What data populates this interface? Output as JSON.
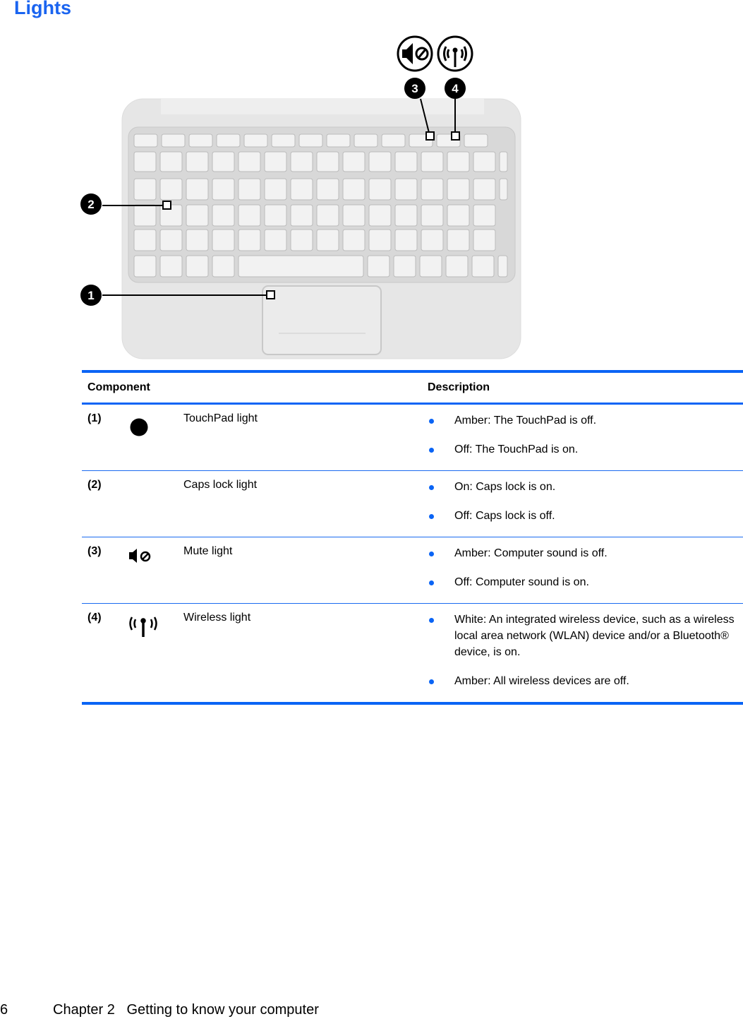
{
  "title": "Lights",
  "figure": {
    "callouts": [
      "1",
      "2",
      "3",
      "4"
    ],
    "callout_icons": [
      "mute-icon",
      "wireless-icon"
    ]
  },
  "table": {
    "headers": [
      "Component",
      "Description"
    ],
    "rows": [
      {
        "num": "(1)",
        "icon": "touchpad-light-icon",
        "name": "TouchPad light",
        "desc": [
          "Amber: The TouchPad is off.",
          "Off: The TouchPad is on."
        ]
      },
      {
        "num": "(2)",
        "icon": "",
        "name": "Caps lock light",
        "desc": [
          "On: Caps lock is on.",
          "Off: Caps lock is off."
        ]
      },
      {
        "num": "(3)",
        "icon": "mute-icon",
        "name": "Mute light",
        "desc": [
          "Amber: Computer sound is off.",
          "Off: Computer sound is on."
        ]
      },
      {
        "num": "(4)",
        "icon": "wireless-icon",
        "name": "Wireless light",
        "desc": [
          "White: An integrated wireless device, such as a wireless local area network (WLAN) device and/or a Bluetooth® device, is on.",
          "Amber: All wireless devices are off."
        ]
      }
    ]
  },
  "footer": {
    "page": "6",
    "chapter": "Chapter 2   Getting to know your computer"
  },
  "colors": {
    "accent": "#0a64f5"
  }
}
